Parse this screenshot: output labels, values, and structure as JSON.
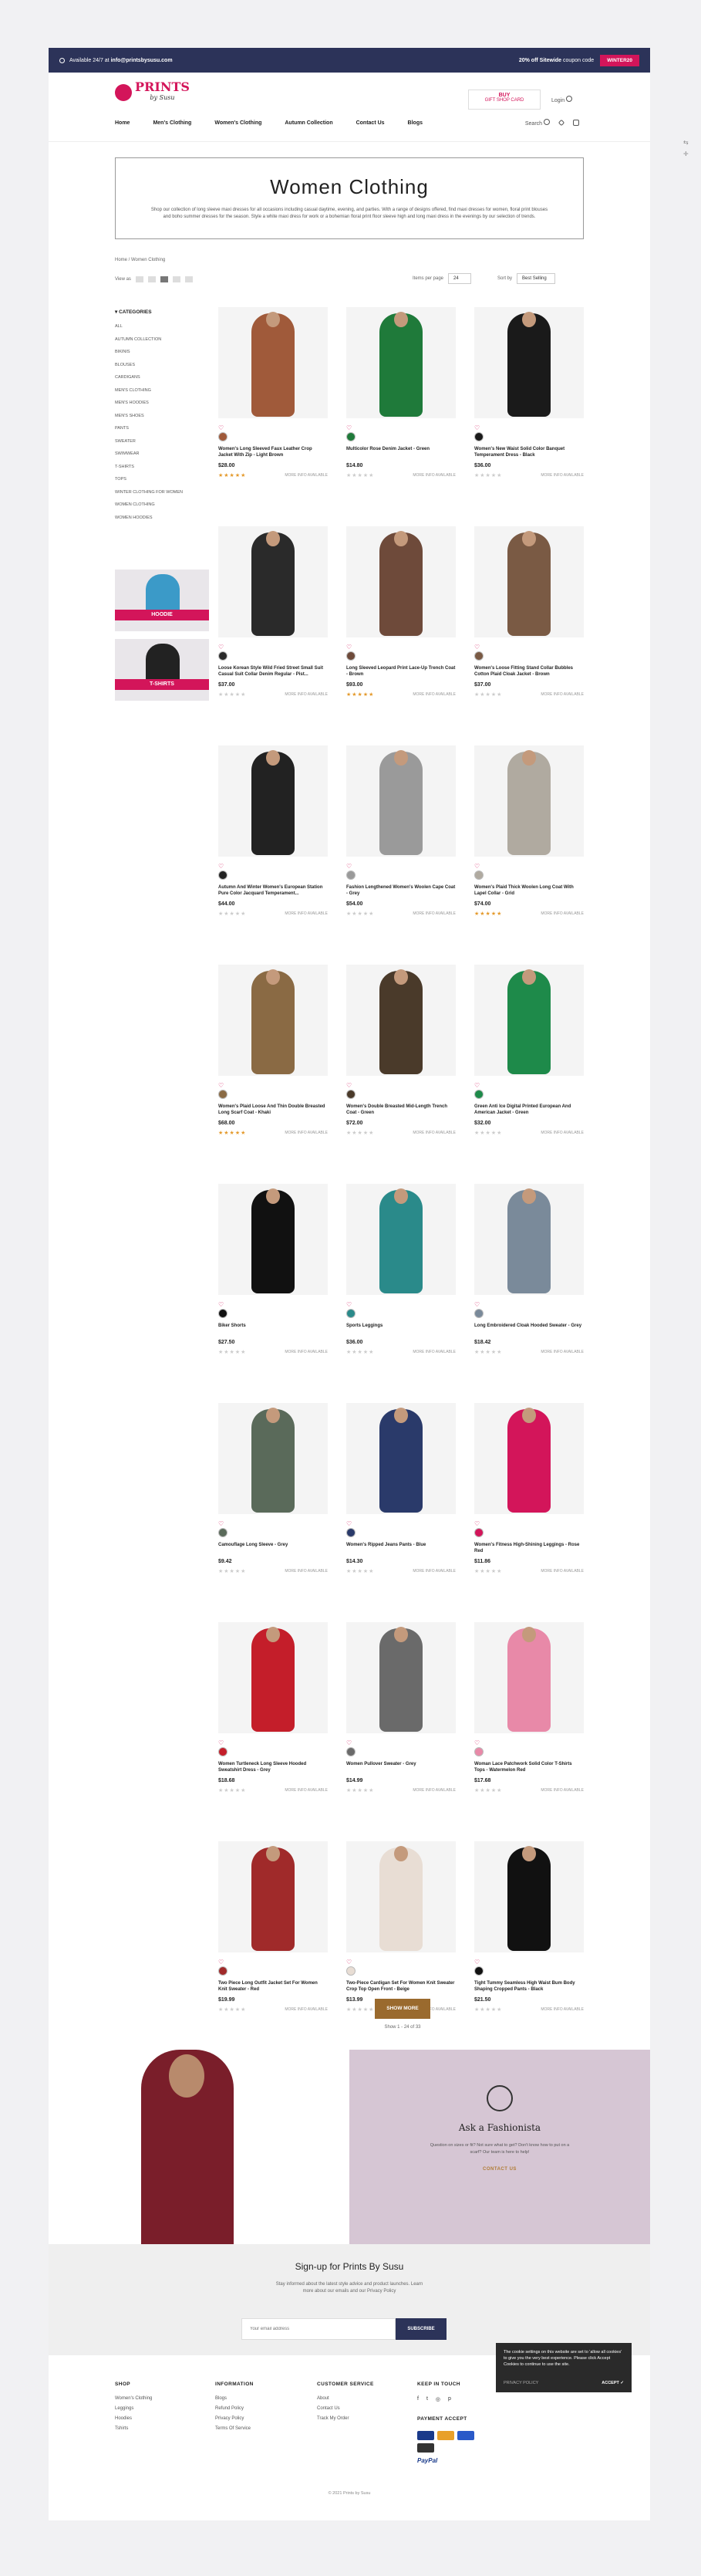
{
  "topbar": {
    "availability": "Available 24/7 at",
    "email": "info@printsbysusu.com",
    "promo_strong": "20% off Sitewide",
    "promo_rest": "coupon code",
    "code_button": "WINTER20"
  },
  "header": {
    "logo_main": "PRINTS",
    "logo_sub": "by Susu",
    "buy_label": "BUY",
    "buy_sub": "GIFT SHOP CARD",
    "login": "Login",
    "search": "Search"
  },
  "nav": [
    "Home",
    "Men's Clothing",
    "Women's Clothing",
    "Autumn Collection",
    "Contact Us",
    "Blogs"
  ],
  "hero": {
    "title": "Women Clothing",
    "text": "Shop our collection of long sleeve maxi dresses for all occasions including casual daytime, evening, and parties. With a range of designs offered, find maxi dresses for women, floral print blouses and boho summer dresses for the season. Style a white maxi dress for work or a bohemian floral print floor sleeve high and long maxi dress in the evenings by our selection of trends."
  },
  "breadcrumb": "Home  /  Women Clothing",
  "toolbar": {
    "view_as": "View as",
    "items_per_page_label": "Items per page",
    "items_per_page": "24",
    "sort_label": "Sort by",
    "sort_value": "Best Selling"
  },
  "sidebar": {
    "title": "CATEGORIES",
    "items": [
      "ALL",
      "AUTUMN COLLECTION",
      "BIKINIS",
      "BLOUSES",
      "CARDIGANS",
      "MEN'S CLOTHING",
      "MEN'S HOODIES",
      "MEN'S SHOES",
      "PANTS",
      "SWEATER",
      "SWIMWEAR",
      "T-SHIRTS",
      "TOPS",
      "WINTER CLOTHING FOR WOMEN",
      "WOMEN CLOTHING",
      "WOMEN HOODIES"
    ],
    "promo1": "HOODIE",
    "promo2": "T-SHIRTS"
  },
  "products": [
    {
      "name": "Women's Long Sleeved Faux Leather Crop Jacket With Zip - Light Brown",
      "price": "$28.00",
      "rated": true,
      "more": "MORE INFO AVAILABLE",
      "color": "#a05a3a"
    },
    {
      "name": "Multicolor Rose Denim Jacket - Green",
      "price": "$14.80",
      "rated": false,
      "more": "MORE INFO AVAILABLE",
      "color": "#1f7a3a"
    },
    {
      "name": "Women's New Waist Solid Color Banquet Temperament Dress - Black",
      "price": "$36.00",
      "rated": false,
      "more": "MORE INFO AVAILABLE",
      "color": "#1a1a1a"
    },
    {
      "name": "Loose Korean Style Wild Fried Street Small Suit Casual Suit Collar Denim Regular - Pist...",
      "price": "$37.00",
      "rated": false,
      "more": "MORE INFO AVAILABLE",
      "color": "#2a2a2a"
    },
    {
      "name": "Long Sleeved Leopard Print Lace-Up Trench Coat - Brown",
      "price": "$93.00",
      "rated": true,
      "more": "MORE INFO AVAILABLE",
      "color": "#6e4a3a"
    },
    {
      "name": "Women's Loose Fitting Stand Collar Bubbles Cotton Plaid Cloak Jacket - Brown",
      "price": "$37.00",
      "rated": false,
      "more": "MORE INFO AVAILABLE",
      "color": "#7a5a44"
    },
    {
      "name": "Autumn And Winter Women's European Station Pure Color Jacquard Temperament...",
      "price": "$44.00",
      "rated": false,
      "more": "MORE INFO AVAILABLE",
      "color": "#222222"
    },
    {
      "name": "Fashion Lengthened Women's Woolen Cape Coat - Grey",
      "price": "$54.00",
      "rated": false,
      "more": "MORE INFO AVAILABLE",
      "color": "#9a9a9a"
    },
    {
      "name": "Women's Plaid Thick Woolen Long Coat With Lapel Collar - Grid",
      "price": "$74.00",
      "rated": true,
      "more": "MORE INFO AVAILABLE",
      "color": "#b0aaa0"
    },
    {
      "name": "Women's Plaid Loose And Thin Double Breasted Long Scarf Coat - Khaki",
      "price": "$68.00",
      "rated": true,
      "more": "MORE INFO AVAILABLE",
      "color": "#8a6a44"
    },
    {
      "name": "Women's Double Breasted Mid-Length Trench Coat - Green",
      "price": "$72.00",
      "rated": false,
      "more": "MORE INFO AVAILABLE",
      "color": "#4a3a2a"
    },
    {
      "name": "Green Anti Ice Digital Printed European And American Jacket - Green",
      "price": "$32.00",
      "rated": false,
      "more": "MORE INFO AVAILABLE",
      "color": "#1e8a4a"
    },
    {
      "name": "Biker Shorts",
      "price": "$27.50",
      "rated": false,
      "more": "MORE INFO AVAILABLE",
      "color": "#111111"
    },
    {
      "name": "Sports Leggings",
      "price": "$36.00",
      "rated": false,
      "more": "MORE INFO AVAILABLE",
      "color": "#2a8a8a"
    },
    {
      "name": "Long Embroidered Cloak Hooded Sweater - Grey",
      "price": "$18.42",
      "rated": false,
      "more": "MORE INFO AVAILABLE",
      "color": "#7a8a9a"
    },
    {
      "name": "Camouflage Long Sleeve - Grey",
      "price": "$9.42",
      "rated": false,
      "more": "MORE INFO AVAILABLE",
      "color": "#5a6a5a"
    },
    {
      "name": "Women's Ripped Jeans Pants - Blue",
      "price": "$14.30",
      "rated": false,
      "more": "MORE INFO AVAILABLE",
      "color": "#2a3a6a"
    },
    {
      "name": "Women's Fitness High-Shining Leggings - Rose Red",
      "price": "$11.86",
      "rated": false,
      "more": "MORE INFO AVAILABLE",
      "color": "#d3155a"
    },
    {
      "name": "Women Turtleneck Long Sleeve Hooded Sweatshirt Dress - Grey",
      "price": "$18.68",
      "rated": false,
      "more": "MORE INFO AVAILABLE",
      "color": "#c41e2a"
    },
    {
      "name": "Women Pullover Sweater - Grey",
      "price": "$14.99",
      "rated": false,
      "more": "MORE INFO AVAILABLE",
      "color": "#6a6a6a"
    },
    {
      "name": "Woman Lace Patchwork Solid Color T-Shirts Tops - Watermelon Red",
      "price": "$17.68",
      "rated": false,
      "more": "MORE INFO AVAILABLE",
      "color": "#e889a8"
    },
    {
      "name": "Two Piece Long Outfit Jacket Set For Women Knit Sweater - Red",
      "price": "$19.99",
      "rated": false,
      "more": "MORE INFO AVAILABLE",
      "color": "#a02a2a"
    },
    {
      "name": "Two-Piece Cardigan Set For Women Knit Sweater Crop Top Open Front - Beige",
      "price": "$13.99",
      "rated": false,
      "more": "MORE INFO AVAILABLE",
      "color": "#e8ddd4"
    },
    {
      "name": "Tight Tummy Seamless High Waist Bum Body Shaping Cropped Pants - Black",
      "price": "$21.50",
      "rated": false,
      "more": "MORE INFO AVAILABLE",
      "color": "#111111"
    }
  ],
  "show_more": "SHOW MORE",
  "show_count": "Show 1 - 24 of 33",
  "fashionista": {
    "title": "Ask a Fashionista",
    "text": "Question on sizes or fit? Not sure what to get? Don't know how to put on a scarf? Our team is here to help!",
    "cta": "CONTACT US"
  },
  "signup": {
    "title": "Sign-up for Prints By Susu",
    "text": "Stay informed about the latest style advice and product launches. Learn more about our emails and our Privacy Policy",
    "placeholder": "Your email address",
    "button": "SUBSCRIBE"
  },
  "footer": {
    "shop": {
      "title": "SHOP",
      "items": [
        "Women's Clothing",
        "Leggings",
        "Hoodies",
        "Tshirts"
      ]
    },
    "information": {
      "title": "INFORMATION",
      "items": [
        "Blogs",
        "Refund Policy",
        "Privacy Policy",
        "Terms Of Service"
      ]
    },
    "customer": {
      "title": "CUSTOMER SERVICE",
      "items": [
        "About",
        "Contact Us",
        "Track My Order"
      ]
    },
    "touch": {
      "title": "KEEP IN TOUCH",
      "social": [
        "f",
        "t",
        "◎",
        "p"
      ]
    },
    "payment_title": "PAYMENT ACCEPT",
    "paypal": "PayPal",
    "copyright": "© 2021 Prints by Susu"
  },
  "cookie": {
    "text": "The cookie settings on this website are set to 'allow all cookies' to give you the very best experience. Please click Accept Cookies to continue to use the site.",
    "privacy": "PRIVACY POLICY",
    "accept": "ACCEPT ✓"
  }
}
